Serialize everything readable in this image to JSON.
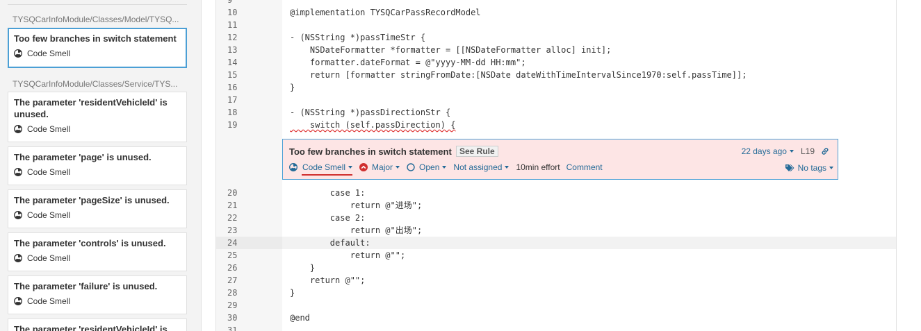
{
  "sidebar": {
    "groups": [
      {
        "path": "TYSQCarInfoModule/Classes/Model/TYSQ...",
        "issues": [
          {
            "title": "Too few branches in switch statement",
            "type": "Code Smell",
            "selected": true
          }
        ]
      },
      {
        "path": "TYSQCarInfoModule/Classes/Service/TYS...",
        "issues": [
          {
            "title": "The parameter 'residentVehicleId' is unused.",
            "type": "Code Smell"
          },
          {
            "title": "The parameter 'page' is unused.",
            "type": "Code Smell"
          },
          {
            "title": "The parameter 'pageSize' is unused.",
            "type": "Code Smell"
          },
          {
            "title": "The parameter 'controls' is unused.",
            "type": "Code Smell"
          },
          {
            "title": "The parameter 'failure' is unused.",
            "type": "Code Smell"
          },
          {
            "title": "The parameter 'residentVehicleId' is",
            "type": ""
          }
        ]
      }
    ]
  },
  "code": {
    "lines_before": [
      {
        "n": "9",
        "text": ""
      },
      {
        "n": "10",
        "text": "@implementation TYSQCarPassRecordModel"
      },
      {
        "n": "11",
        "text": ""
      },
      {
        "n": "12",
        "text": "- (NSString *)passTimeStr {"
      },
      {
        "n": "13",
        "text": "    NSDateFormatter *formatter = [[NSDateFormatter alloc] init];"
      },
      {
        "n": "14",
        "text": "    formatter.dateFormat = @\"yyyy-MM-dd HH:mm\";"
      },
      {
        "n": "15",
        "text": "    return [formatter stringFromDate:[NSDate dateWithTimeIntervalSince1970:self.passTime]];"
      },
      {
        "n": "16",
        "text": "}"
      },
      {
        "n": "17",
        "text": ""
      },
      {
        "n": "18",
        "text": "- (NSString *)passDirectionStr {"
      },
      {
        "n": "19",
        "text": "    switch (self.passDirection) {"
      }
    ],
    "lines_after": [
      {
        "n": "20",
        "text": "        case 1:"
      },
      {
        "n": "21",
        "text": "            return @\"进场\";"
      },
      {
        "n": "22",
        "text": "        case 2:"
      },
      {
        "n": "23",
        "text": "            return @\"出场\";"
      },
      {
        "n": "24",
        "text": "        default:"
      },
      {
        "n": "25",
        "text": "            return @\"\";"
      },
      {
        "n": "26",
        "text": "    }"
      },
      {
        "n": "27",
        "text": "    return @\"\";"
      },
      {
        "n": "28",
        "text": "}"
      },
      {
        "n": "29",
        "text": ""
      },
      {
        "n": "30",
        "text": "@end"
      },
      {
        "n": "31",
        "text": ""
      }
    ],
    "highlighted_line": "24",
    "flagged_line": "19"
  },
  "issue": {
    "title": "Too few branches in switch statement",
    "see_rule": "See Rule",
    "type": "Code Smell",
    "severity": "Major",
    "status": "Open",
    "assignee": "Not assigned",
    "effort": "10min effort",
    "comment": "Comment",
    "age": "22 days ago",
    "line": "L19",
    "tags": "No tags"
  },
  "colors": {
    "accent": "#4b9fd5",
    "link": "#236a97",
    "issue_bg": "#fde5e5",
    "severity_major": "#d02f2f"
  }
}
